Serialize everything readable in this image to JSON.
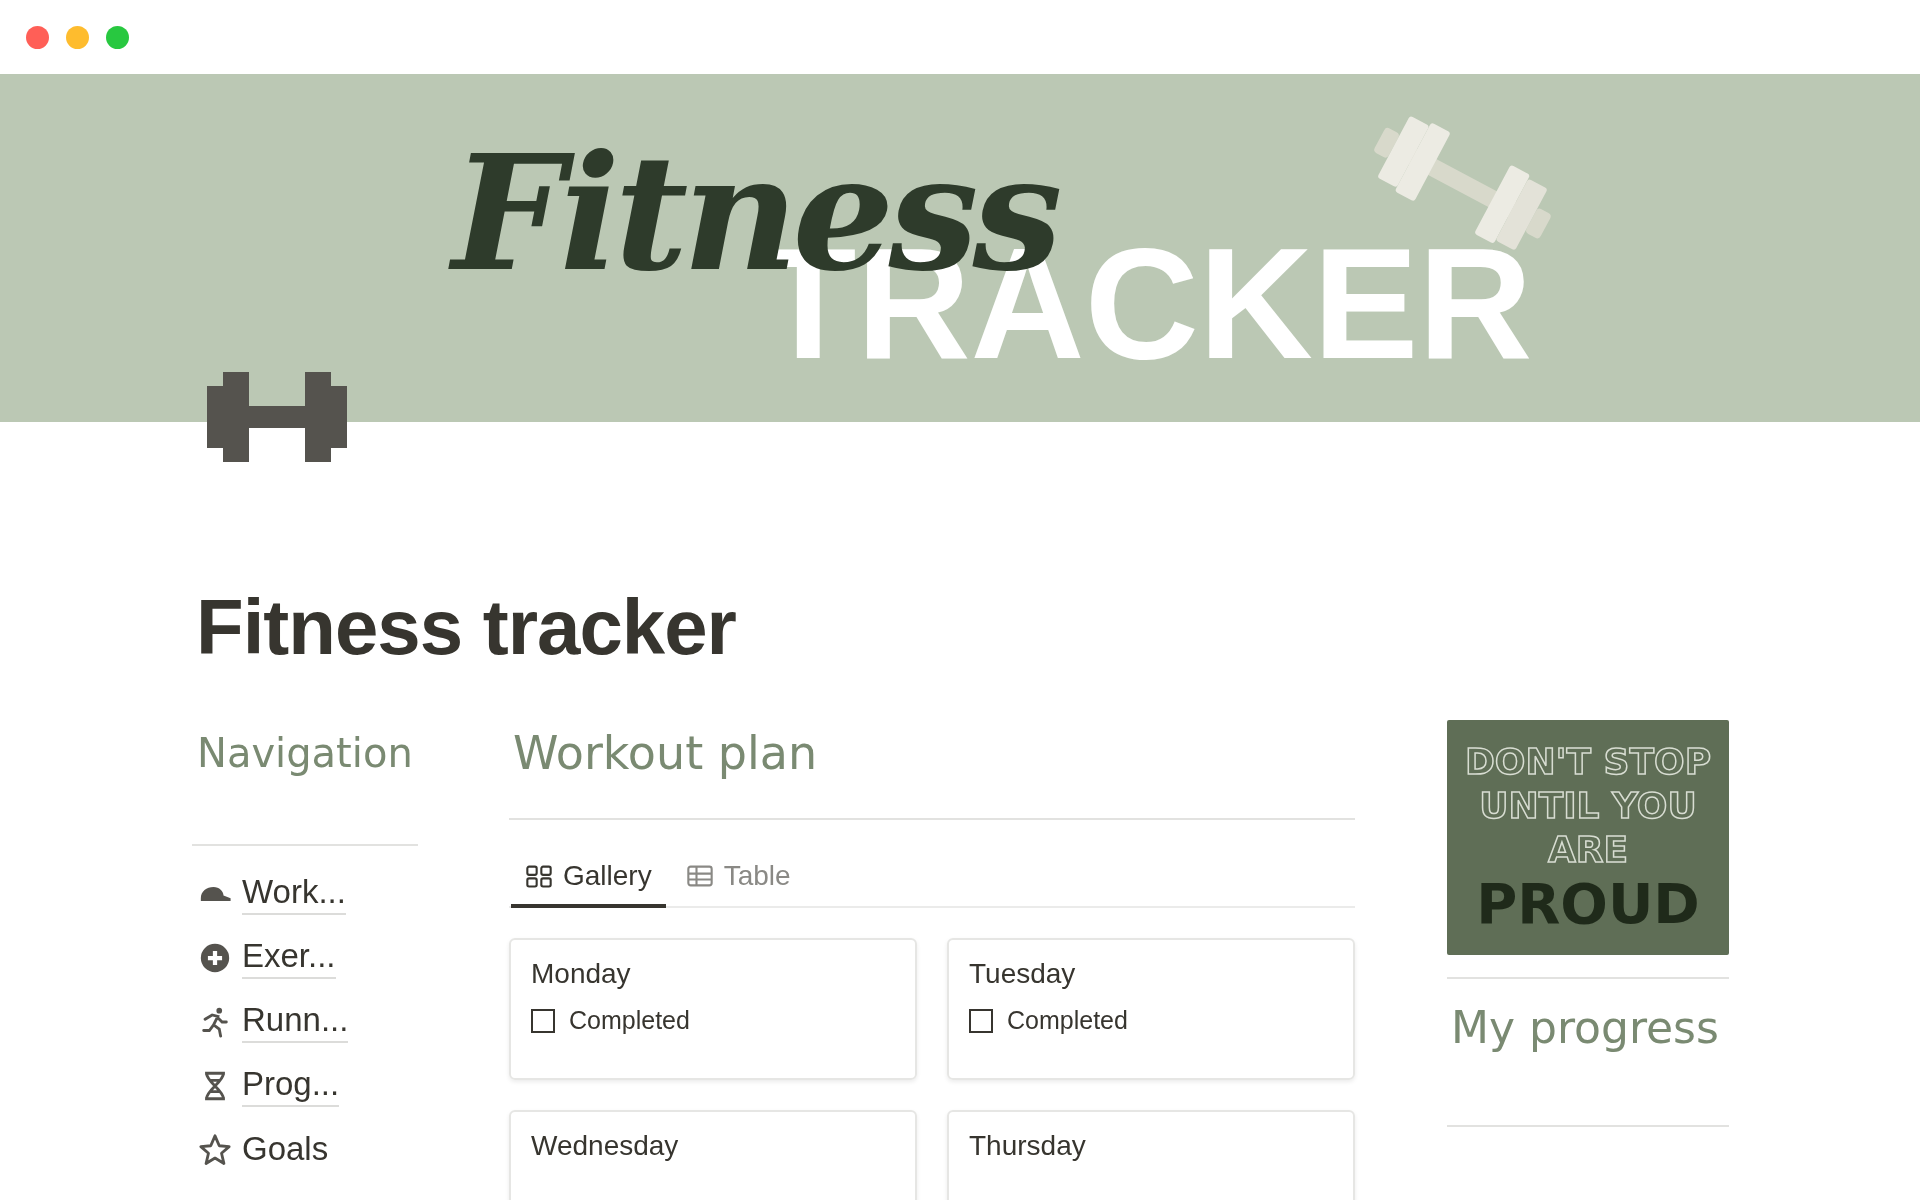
{
  "window": {
    "controls": [
      {
        "kind": "close"
      },
      {
        "kind": "minimize"
      },
      {
        "kind": "maximize"
      }
    ]
  },
  "banner": {
    "script_title": "Fitness",
    "block_title": "TRACKER"
  },
  "page": {
    "title": "Fitness tracker"
  },
  "navigation": {
    "heading": "Navigation",
    "items": [
      {
        "label": "Work...",
        "linked": true
      },
      {
        "label": "Exer...",
        "linked": true
      },
      {
        "label": "Runn...",
        "linked": true
      },
      {
        "label": "Prog...",
        "linked": true
      },
      {
        "label": "Goals",
        "linked": false
      }
    ]
  },
  "workout_plan": {
    "heading": "Workout plan",
    "tabs": [
      {
        "label": "Gallery",
        "selected": true
      },
      {
        "label": "Table",
        "selected": false
      }
    ],
    "cards": [
      {
        "title": "Monday",
        "property": "Completed",
        "checked": false
      },
      {
        "title": "Tuesday",
        "property": "Completed",
        "checked": false
      },
      {
        "title": "Wednesday"
      },
      {
        "title": "Thursday"
      }
    ]
  },
  "sidebar": {
    "poster": {
      "outline_lines": [
        "DON'T STOP",
        "UNTIL YOU",
        "ARE"
      ],
      "bold_line": "PROUD"
    },
    "heading": "My progress"
  }
}
